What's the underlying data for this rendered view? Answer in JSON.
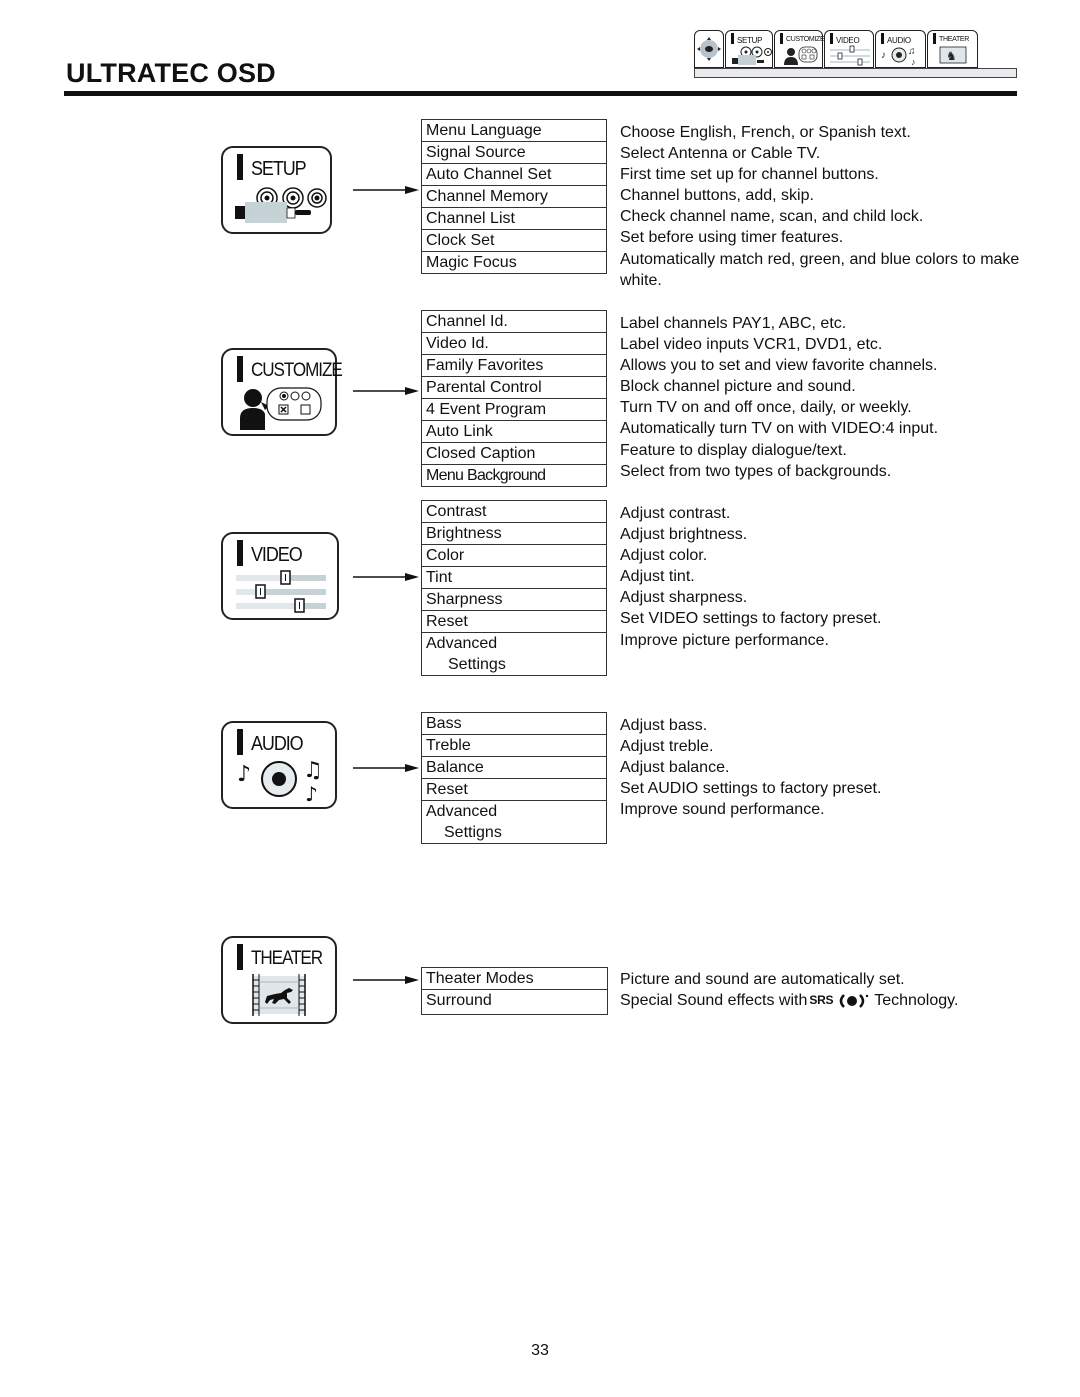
{
  "header": {
    "title": "ULTRATEC OSD",
    "tabs": [
      {
        "id": "nav",
        "label": "",
        "icon": "dpad-icon"
      },
      {
        "id": "setup",
        "label": "SETUP",
        "icon": "setup-icon"
      },
      {
        "id": "customize",
        "label": "CUSTOMIZE",
        "icon": "customize-icon"
      },
      {
        "id": "video",
        "label": "VIDEO",
        "icon": "video-icon"
      },
      {
        "id": "audio",
        "label": "AUDIO",
        "icon": "audio-icon"
      },
      {
        "id": "theater",
        "label": "THEATER",
        "icon": "theater-icon"
      }
    ]
  },
  "sections": {
    "setup": {
      "label": "SETUP",
      "items": [
        "Menu Language",
        "Signal Source",
        "Auto Channel Set",
        "Channel Memory",
        "Channel List",
        "Clock Set",
        "Magic Focus"
      ],
      "descriptions": [
        "Choose English, French, or Spanish text.",
        "Select Antenna or Cable TV.",
        "First time set up for channel buttons.",
        "Channel buttons, add, skip.",
        "Check channel name, scan, and child lock.",
        "Set before using timer features.",
        "Automatically match red, green, and blue colors to make white."
      ]
    },
    "customize": {
      "label": "CUSTOMIZE",
      "items": [
        "Channel Id.",
        "Video Id.",
        "Family Favorites",
        "Parental Control",
        "4 Event Program",
        "Auto Link",
        "Closed Caption",
        "Menu Background"
      ],
      "descriptions": [
        "Label channels PAY1, ABC, etc.",
        "Label video inputs VCR1, DVD1, etc.",
        "Allows you to set and view favorite channels.",
        "Block channel picture and sound.",
        "Turn TV on and off once, daily, or weekly.",
        "Automatically turn TV on with VIDEO:4 input.",
        "Feature to display dialogue/text.",
        "Select from two types of backgrounds."
      ]
    },
    "video": {
      "label": "VIDEO",
      "items": [
        "Contrast",
        "Brightness",
        "Color",
        "Tint",
        "Sharpness",
        "Reset"
      ],
      "advanced": {
        "line1": "Advanced",
        "line2": "Settings"
      },
      "descriptions": [
        "Adjust contrast.",
        "Adjust brightness.",
        "Adjust color.",
        "Adjust tint.",
        "Adjust sharpness.",
        "Set VIDEO settings to factory preset.",
        "Improve picture performance."
      ]
    },
    "audio": {
      "label": "AUDIO",
      "items": [
        "Bass",
        "Treble",
        "Balance",
        "Reset"
      ],
      "advanced": {
        "line1": "Advanced",
        "line2": "Settigns"
      },
      "descriptions": [
        "Adjust bass.",
        "Adjust treble.",
        "Adjust balance.",
        "Set AUDIO settings to factory preset.",
        "Improve sound performance."
      ]
    },
    "theater": {
      "label": "THEATER",
      "items": [
        "Theater Modes",
        "Surround"
      ],
      "descriptions": [
        "Picture and sound are automatically set.",
        {
          "before": "Special Sound effects with",
          "logo": "SRS",
          "after": "Technology."
        }
      ]
    }
  },
  "footer": {
    "page_number": "33"
  }
}
